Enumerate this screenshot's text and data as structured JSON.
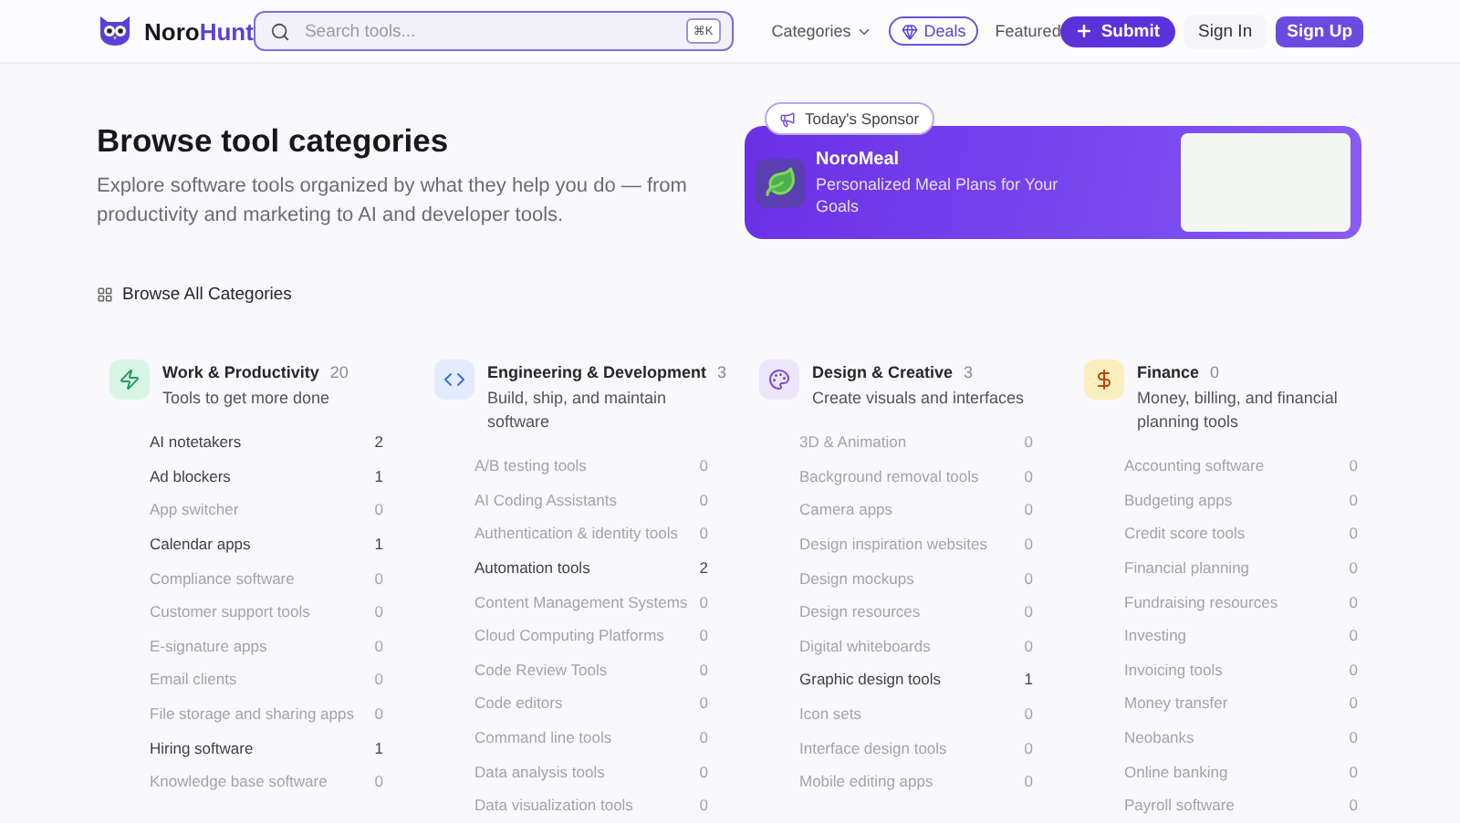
{
  "header": {
    "brand": {
      "name": "Noro",
      "accent": "Hunt"
    },
    "search": {
      "placeholder": "Search tools...",
      "shortcut": "⌘K"
    },
    "nav": [
      {
        "kind": "dropdown",
        "label": "Categories"
      },
      {
        "kind": "pill",
        "label": "Deals"
      },
      {
        "kind": "link",
        "label": "Featured"
      }
    ],
    "actions": [
      {
        "kind": "primary",
        "label": "Submit"
      },
      {
        "kind": "ghost",
        "label": "Sign In"
      },
      {
        "kind": "solid",
        "label": "Sign Up"
      }
    ]
  },
  "hero": {
    "title": "Browse tool categories",
    "description": "Explore software tools organized by what they help you do — from productivity and marketing to AI and developer tools."
  },
  "sponsor": {
    "badge": "Today's Sponsor",
    "name": "NoroMeal",
    "tagline": "Personalized Meal Plans for Your Goals"
  },
  "browse_all": "Browse All Categories",
  "categories": [
    {
      "kind": "bolt",
      "color": "#d9f5e6",
      "name": "Work & Productivity",
      "count": "20",
      "description": "Tools to get more done",
      "items": [
        {
          "name": "AI notetakers",
          "count": "2",
          "muted": false
        },
        {
          "name": "Ad blockers",
          "count": "1",
          "muted": false
        },
        {
          "name": "App switcher",
          "count": "0",
          "muted": true
        },
        {
          "name": "Calendar apps",
          "count": "1",
          "muted": false
        },
        {
          "name": "Compliance software",
          "count": "0",
          "muted": true
        },
        {
          "name": "Customer support tools",
          "count": "0",
          "muted": true
        },
        {
          "name": "E-signature apps",
          "count": "0",
          "muted": true
        },
        {
          "name": "Email clients",
          "count": "0",
          "muted": true
        },
        {
          "name": "File storage and sharing apps",
          "count": "0",
          "muted": true
        },
        {
          "name": "Hiring software",
          "count": "1",
          "muted": false
        },
        {
          "name": "Knowledge base software",
          "count": "0",
          "muted": true
        }
      ]
    },
    {
      "kind": "code",
      "color": "#e3ebfc",
      "name": "Engineering & Development",
      "count": "3",
      "description": "Build, ship, and maintain software",
      "items": [
        {
          "name": "A/B testing tools",
          "count": "0",
          "muted": true
        },
        {
          "name": "AI Coding Assistants",
          "count": "0",
          "muted": true
        },
        {
          "name": "Authentication & identity tools",
          "count": "0",
          "muted": true
        },
        {
          "name": "Automation tools",
          "count": "2",
          "muted": false
        },
        {
          "name": "Content Management Systems",
          "count": "0",
          "muted": true
        },
        {
          "name": "Cloud Computing Platforms",
          "count": "0",
          "muted": true
        },
        {
          "name": "Code Review Tools",
          "count": "0",
          "muted": true
        },
        {
          "name": "Code editors",
          "count": "0",
          "muted": true
        },
        {
          "name": "Command line tools",
          "count": "0",
          "muted": true
        },
        {
          "name": "Data analysis tools",
          "count": "0",
          "muted": true
        },
        {
          "name": "Data visualization tools",
          "count": "0",
          "muted": true
        }
      ]
    },
    {
      "kind": "palette",
      "color": "#ece6fa",
      "name": "Design & Creative",
      "count": "3",
      "description": "Create visuals and interfaces",
      "items": [
        {
          "name": "3D & Animation",
          "count": "0",
          "muted": true
        },
        {
          "name": "Background removal tools",
          "count": "0",
          "muted": true
        },
        {
          "name": "Camera apps",
          "count": "0",
          "muted": true
        },
        {
          "name": "Design inspiration websites",
          "count": "0",
          "muted": true
        },
        {
          "name": "Design mockups",
          "count": "0",
          "muted": true
        },
        {
          "name": "Design resources",
          "count": "0",
          "muted": true
        },
        {
          "name": "Digital whiteboards",
          "count": "0",
          "muted": true
        },
        {
          "name": "Graphic design tools",
          "count": "1",
          "muted": false
        },
        {
          "name": "Icon sets",
          "count": "0",
          "muted": true
        },
        {
          "name": "Interface design tools",
          "count": "0",
          "muted": true
        },
        {
          "name": "Mobile editing apps",
          "count": "0",
          "muted": true
        }
      ]
    },
    {
      "kind": "dollar",
      "color": "#fbefc0",
      "name": "Finance",
      "count": "0",
      "description": "Money, billing, and financial planning tools",
      "items": [
        {
          "name": "Accounting software",
          "count": "0",
          "muted": true
        },
        {
          "name": "Budgeting apps",
          "count": "0",
          "muted": true
        },
        {
          "name": "Credit score tools",
          "count": "0",
          "muted": true
        },
        {
          "name": "Financial planning",
          "count": "0",
          "muted": true
        },
        {
          "name": "Fundraising resources",
          "count": "0",
          "muted": true
        },
        {
          "name": "Investing",
          "count": "0",
          "muted": true
        },
        {
          "name": "Invoicing tools",
          "count": "0",
          "muted": true
        },
        {
          "name": "Money transfer",
          "count": "0",
          "muted": true
        },
        {
          "name": "Neobanks",
          "count": "0",
          "muted": true
        },
        {
          "name": "Online banking",
          "count": "0",
          "muted": true
        },
        {
          "name": "Payroll software",
          "count": "0",
          "muted": true
        }
      ]
    }
  ]
}
